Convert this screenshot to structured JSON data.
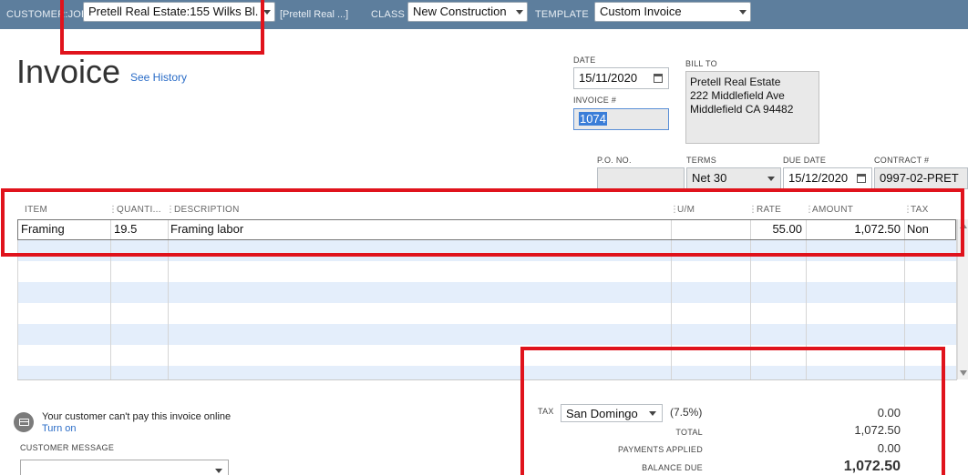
{
  "topbar": {
    "customer_job_label": "CUSTOMER:JOB",
    "customer_job_value": "Pretell Real Estate:155 Wilks Bl...",
    "customer_job_hint": "[Pretell Real ...]",
    "class_label": "CLASS",
    "class_value": "New Construction",
    "template_label": "TEMPLATE",
    "template_value": "Custom Invoice",
    "bar_color": "#5d7e9d"
  },
  "header": {
    "title": "Invoice",
    "see_history": "See History"
  },
  "form": {
    "date_label": "DATE",
    "date_value": "15/11/2020",
    "invoice_label": "INVOICE #",
    "invoice_value": "1074",
    "bill_to_label": "BILL TO",
    "bill_to_lines": [
      "Pretell Real Estate",
      "222 Middlefield Ave",
      "Middlefield  CA 94482"
    ],
    "po_label": "P.O. NO.",
    "po_value": "",
    "terms_label": "TERMS",
    "terms_value": "Net 30",
    "due_date_label": "DUE DATE",
    "due_date_value": "15/12/2020",
    "contract_label": "CONTRACT #",
    "contract_value": "0997-02-PRET"
  },
  "grid": {
    "columns": [
      "ITEM",
      "QUANTI...",
      "DESCRIPTION",
      "U/M",
      "RATE",
      "AMOUNT",
      "TAX"
    ],
    "rows": [
      {
        "item": "Framing",
        "quantity": "19.5",
        "description": "Framing labor",
        "um": "",
        "rate": "55.00",
        "amount": "1,072.50",
        "tax": "Non"
      }
    ]
  },
  "online_payment": {
    "message": "Your customer can't pay this invoice online",
    "turn_on": "Turn on",
    "icon": "credit-card-icon"
  },
  "customer_message": {
    "label": "CUSTOMER MESSAGE",
    "value": ""
  },
  "totals": {
    "tax_label": "TAX",
    "tax_item": "San Domingo",
    "tax_rate": "(7.5%)",
    "tax_amount": "0.00",
    "total_label": "TOTAL",
    "total_value": "1,072.50",
    "payments_label": "PAYMENTS APPLIED",
    "payments_value": "0.00",
    "balance_label": "BALANCE DUE",
    "balance_value": "1,072.50"
  },
  "colors": {
    "highlight": "#e0131c",
    "row_alt": "#e4eefb",
    "link": "#2a6cc7"
  }
}
